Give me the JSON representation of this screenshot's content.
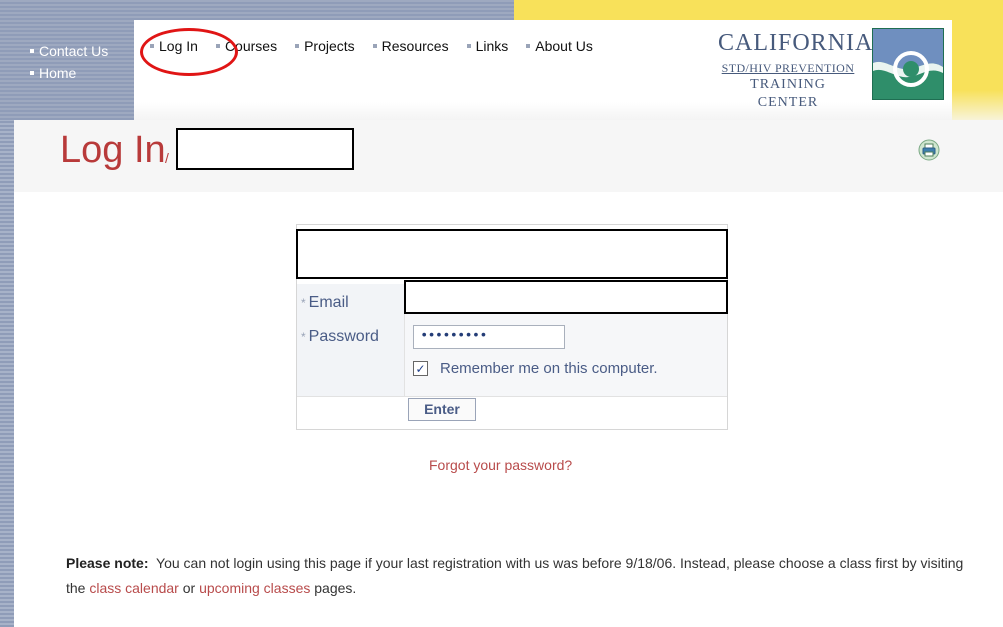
{
  "utility_nav": {
    "contact_us": "Contact Us",
    "home": "Home"
  },
  "main_nav": {
    "items": [
      "Log In",
      "Courses",
      "Projects",
      "Resources",
      "Links",
      "About Us"
    ]
  },
  "logo": {
    "line1": "CALIFORNIA",
    "line2": "STD/HIV PREVENTION",
    "line3": "TRAINING CENTER",
    "icon": "wave-logo-icon"
  },
  "page": {
    "title": "Log In",
    "breadcrumb_separator": "/",
    "print_icon": "printer-icon"
  },
  "login_form": {
    "email_label": "Email",
    "password_label": "Password",
    "required_marker": "*",
    "password_value": "•••••••••",
    "remember_label": "Remember me on this computer.",
    "remember_checked": true,
    "submit_label": "Enter",
    "forgot_link": "Forgot your password?"
  },
  "note": {
    "lead": "Please note:",
    "text_before": "You can not login using this page if your last registration with us was before 9/18/06.  Instead, please choose a class first by visiting the",
    "link1": "class calendar",
    "text_between": "or",
    "link2": "upcoming classes",
    "text_after": "pages."
  },
  "colors": {
    "title_red": "#b83a3a",
    "link_red": "#b84b4b",
    "label_blue": "#4a5c86",
    "header_yellow": "#f8e15a",
    "header_blue_gray": "#9ea9c0",
    "annotation_red": "#e01515"
  }
}
